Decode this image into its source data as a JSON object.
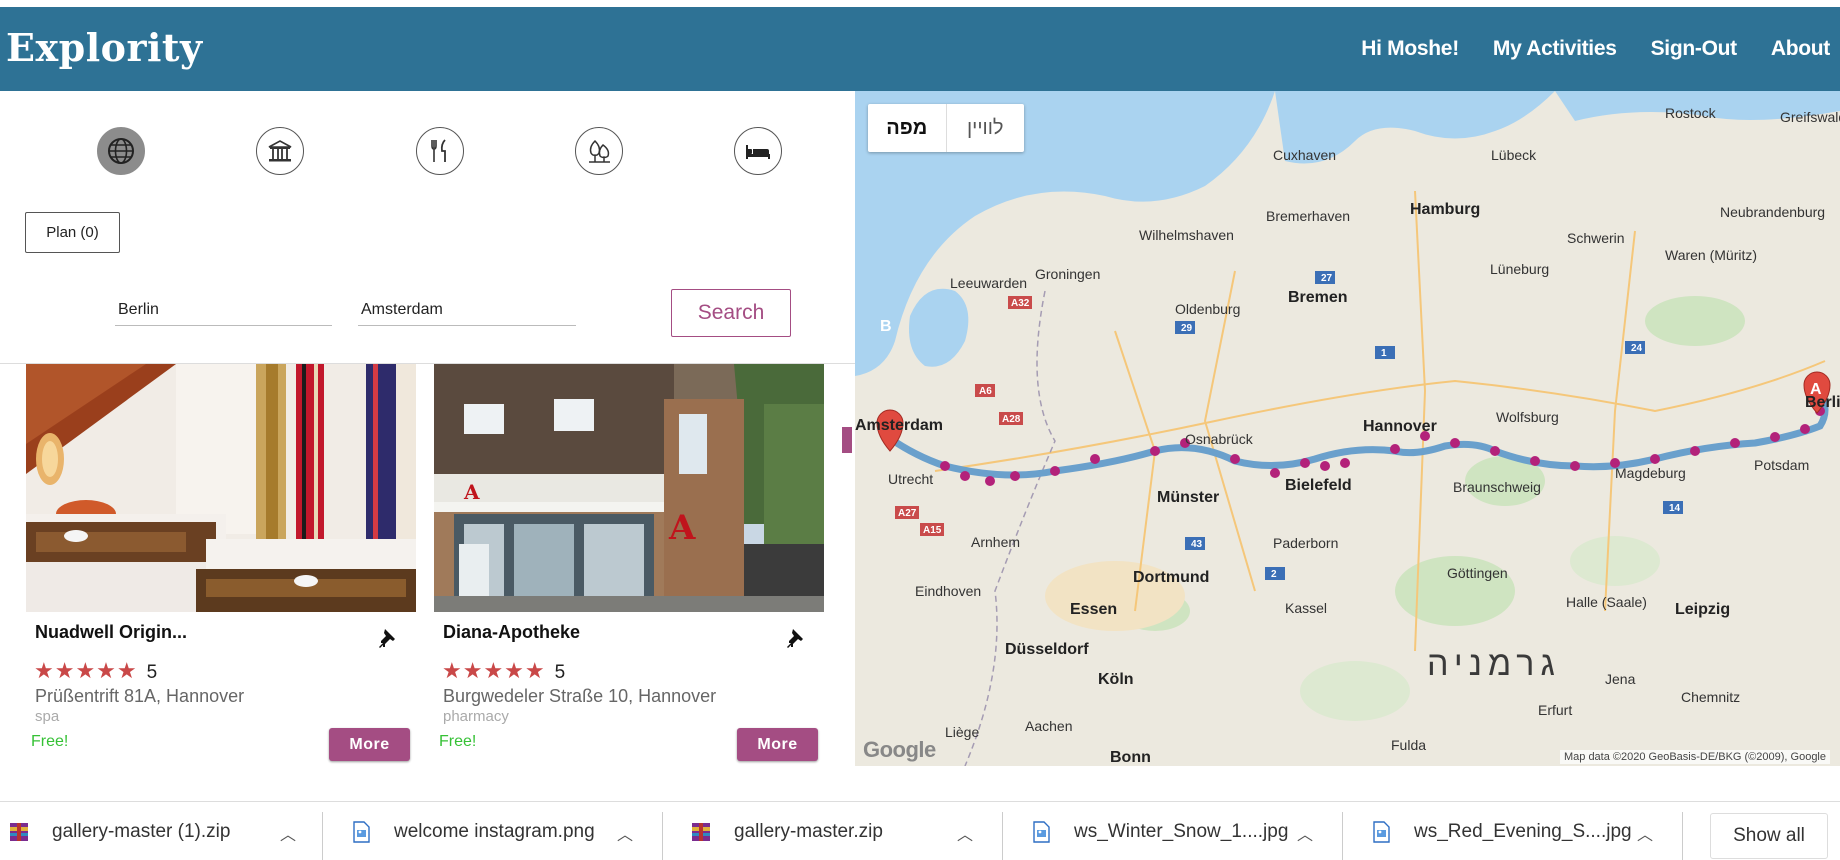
{
  "header": {
    "brand": "Explority",
    "nav": [
      "Hi Moshe!",
      "My Activities",
      "Sign-Out",
      "About"
    ],
    "bg_color": "#2e7295"
  },
  "categories": [
    "globe-icon",
    "museum-icon",
    "restaurant-icon",
    "nature-icon",
    "hotel-icon"
  ],
  "plan": {
    "label": "Plan (0)"
  },
  "search": {
    "origin": "Berlin",
    "destination": "Amsterdam",
    "button": "Search"
  },
  "cards": [
    {
      "title": "Nuadwell Origin...",
      "stars": "★★★★★",
      "rating": "5",
      "address": "Prüßentrift 81A, Hannover",
      "category": "spa",
      "price": "Free!",
      "more": "More"
    },
    {
      "title": "Diana-Apotheke",
      "stars": "★★★★★",
      "rating": "5",
      "address": "Burgwedeler Straße 10, Hannover",
      "category": "pharmacy",
      "price": "Free!",
      "more": "More"
    }
  ],
  "map": {
    "toggle_map": "מפה",
    "toggle_satellite": "לוויין",
    "marker_a": "A",
    "marker_b": "B",
    "country": "גרמניה",
    "credit": "Map data ©2020 GeoBasis-DE/BKG (©2009), Google",
    "logo": "Google",
    "cities": [
      "Rostock",
      "Lübeck",
      "Cuxhaven",
      "Hamburg",
      "Bremerhaven",
      "Wilhelmshaven",
      "Schwerin",
      "Groningen",
      "Leeuwarden",
      "Oldenburg",
      "Bremen",
      "Lüneburg",
      "Neubrandenburg",
      "Waren (Müritz)",
      "Wolfsburg",
      "Hannover",
      "Osnabrück",
      "Amsterdam",
      "Utrecht",
      "Bielefeld",
      "Münster",
      "Braunschweig",
      "Magdeburg",
      "Potsdam",
      "Berlin",
      "Arnhem",
      "Paderborn",
      "Dortmund",
      "Göttingen",
      "Halle (Saale)",
      "Leipzig",
      "Eindhoven",
      "Essen",
      "Kassel",
      "Düsseldorf",
      "Köln",
      "Jena",
      "Erfurt",
      "Chemnitz",
      "Liège",
      "Aachen",
      "Bonn",
      "Fulda",
      "Greifswald"
    ]
  },
  "downloads": [
    {
      "name": "gallery-master (1).zip",
      "type": "zip"
    },
    {
      "name": "welcome instagram.png",
      "type": "image"
    },
    {
      "name": "gallery-master.zip",
      "type": "zip"
    },
    {
      "name": "ws_Winter_Snow_1....jpg",
      "type": "image"
    },
    {
      "name": "ws_Red_Evening_S....jpg",
      "type": "image"
    }
  ],
  "show_all": "Show all",
  "accent_color": "#a44d83"
}
